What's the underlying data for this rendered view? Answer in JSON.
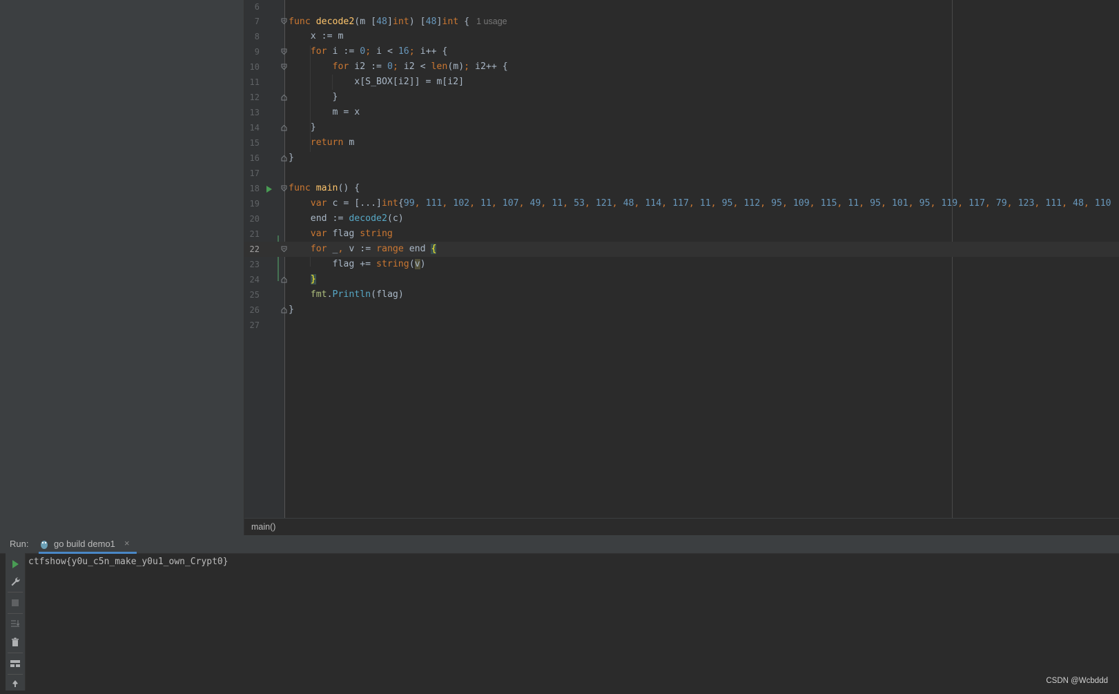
{
  "editor": {
    "lines": [
      {
        "number": "6"
      },
      {
        "number": "7",
        "usage_hint": "1 usage"
      },
      {
        "number": "8"
      },
      {
        "number": "9"
      },
      {
        "number": "10"
      },
      {
        "number": "11"
      },
      {
        "number": "12"
      },
      {
        "number": "13"
      },
      {
        "number": "14"
      },
      {
        "number": "15"
      },
      {
        "number": "16"
      },
      {
        "number": "17"
      },
      {
        "number": "18"
      },
      {
        "number": "19"
      },
      {
        "number": "20"
      },
      {
        "number": "21"
      },
      {
        "number": "22"
      },
      {
        "number": "23"
      },
      {
        "number": "24"
      },
      {
        "number": "25"
      },
      {
        "number": "26"
      },
      {
        "number": "27"
      }
    ],
    "c_values": [
      "99",
      "111",
      "102",
      "11",
      "107",
      "49",
      "11",
      "53",
      "121",
      "48",
      "114",
      "117",
      "11",
      "95",
      "112",
      "95",
      "109",
      "115",
      "11",
      "95",
      "101",
      "95",
      "119",
      "117",
      "79",
      "123",
      "111",
      "48",
      "110"
    ]
  },
  "breadcrumb": {
    "label": "main()"
  },
  "run_panel": {
    "label": "Run:",
    "tab_label": "go build demo1",
    "tab_close": "×",
    "output": "ctfshow{y0u_c5n_make_y0u1_own_Crypt0}"
  },
  "watermark": "CSDN @Wcbddd",
  "colors": {
    "background": "#2b2b2b",
    "keyword": "#cc7832",
    "function": "#ffc66d",
    "number": "#6897bb",
    "text": "#a9b7c6"
  }
}
